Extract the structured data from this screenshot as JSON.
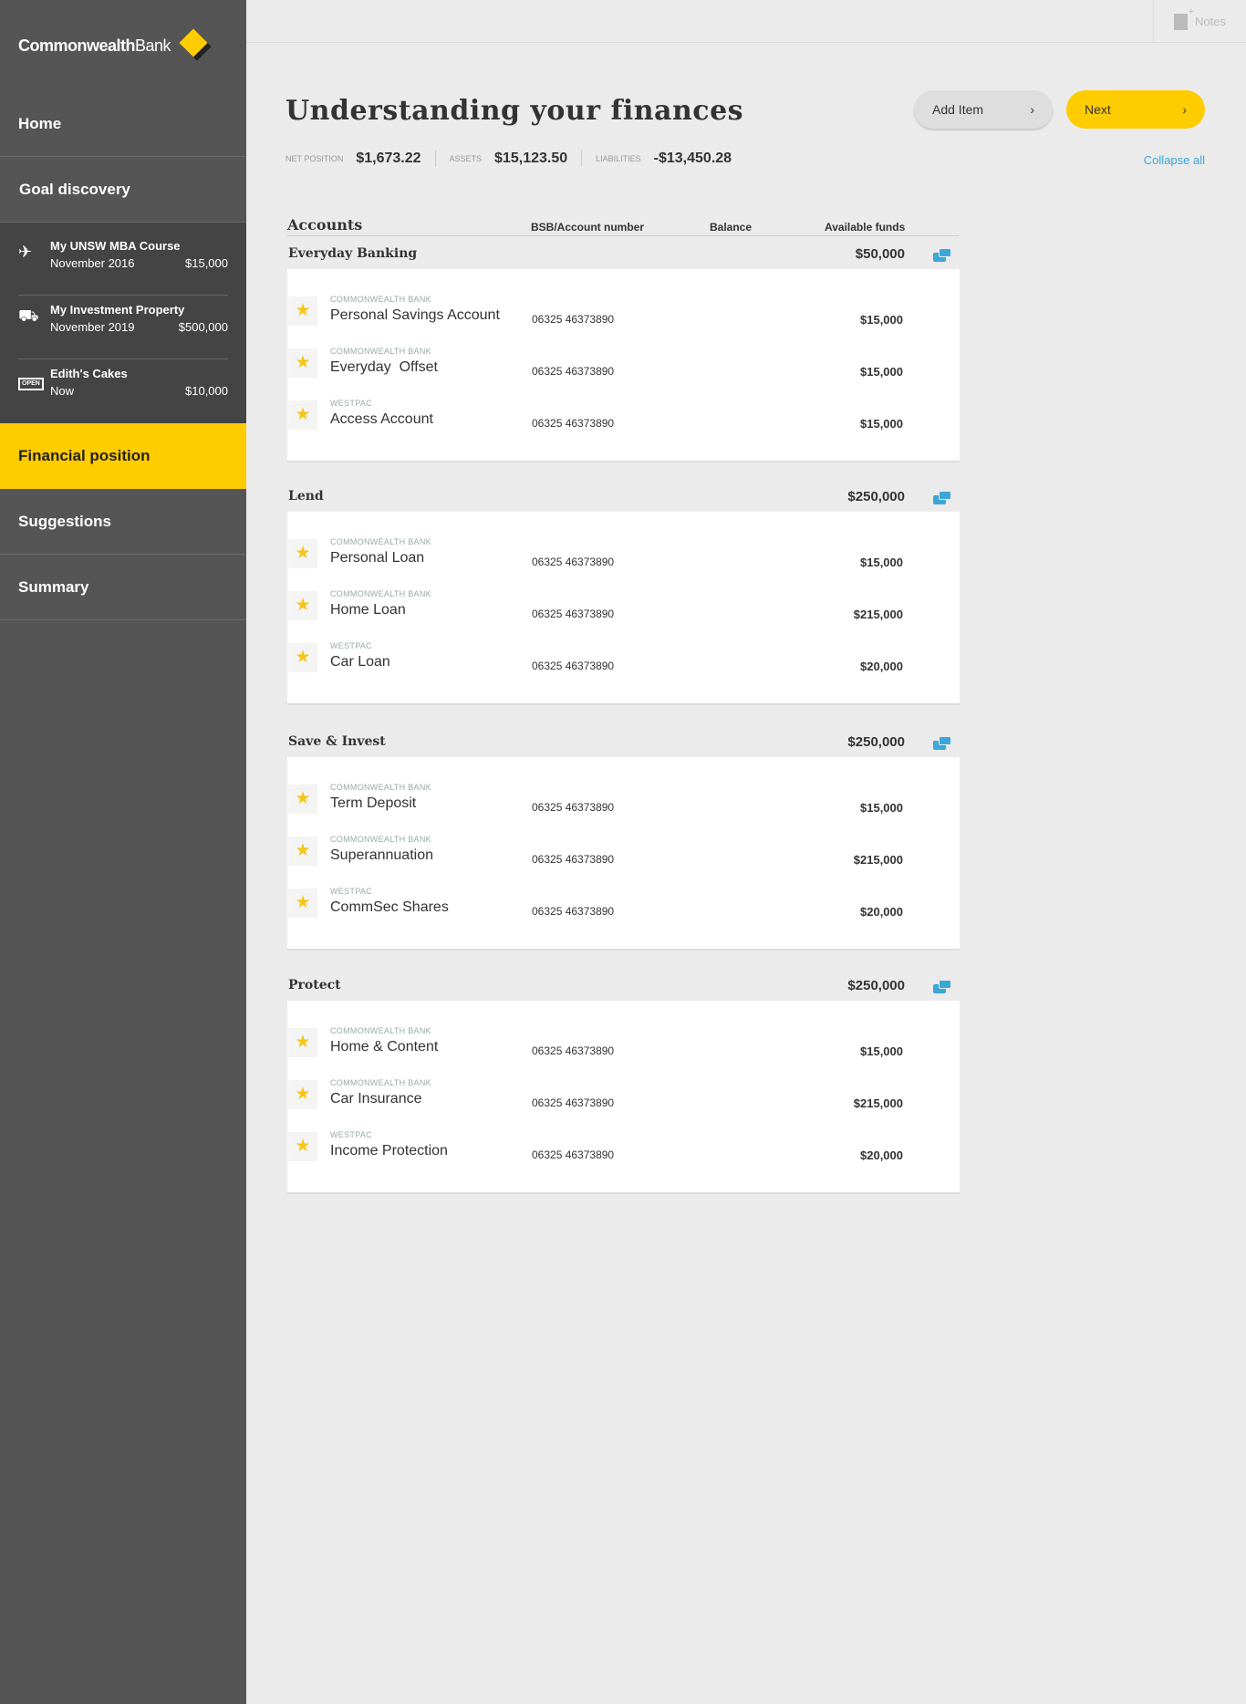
{
  "brand": {
    "logo_bold": "Commonwealth",
    "logo_regular": "Bank"
  },
  "sidebar": {
    "home": "Home",
    "goal_discovery": "Goal discovery",
    "goals": [
      {
        "icon": "plane-icon",
        "title": "My UNSW MBA Course",
        "date": "November 2016",
        "amount": "$15,000"
      },
      {
        "icon": "car-icon",
        "title": "My Investment Property",
        "date": "November 2019",
        "amount": "$500,000"
      },
      {
        "icon": "open-sign-icon",
        "icon_text": "OPEN",
        "title": "Edith's Cakes",
        "date": "Now",
        "amount": "$10,000"
      }
    ],
    "financial_position": "Financial position",
    "suggestions": "Suggestions",
    "summary": "Summary"
  },
  "topbar": {
    "notes": "Notes"
  },
  "header": {
    "title": "Understanding your finances",
    "add_item": "Add Item",
    "next": "Next",
    "chevron": "›",
    "net_position_label": "NET POSITION",
    "net_position": "$1,673.22",
    "assets_label": "ASSETS",
    "assets": "$15,123.50",
    "liabilities_label": "LIABILITIES",
    "liabilities": "-$13,450.28",
    "collapse_all": "Collapse all"
  },
  "table": {
    "headers": {
      "accounts": "Accounts",
      "bsb": "BSB/Account number",
      "balance": "Balance",
      "available": "Available funds"
    },
    "sections": [
      {
        "title": "Everyday Banking",
        "total": "$50,000",
        "rows": [
          {
            "bank": "COMMONWEALTH BANK",
            "name": "Personal Savings Account",
            "bsb": "06325 46373890",
            "amount": "$15,000"
          },
          {
            "bank": "COMMONWEALTH BANK",
            "name": "Everyday  Offset",
            "bsb": "06325 46373890",
            "amount": "$15,000"
          },
          {
            "bank": "WESTPAC",
            "name": "Access Account",
            "bsb": "06325 46373890",
            "amount": "$15,000"
          }
        ]
      },
      {
        "title": "Lend",
        "total": "$250,000",
        "rows": [
          {
            "bank": "COMMONWEALTH BANK",
            "name": "Personal Loan",
            "bsb": "06325 46373890",
            "amount": "$15,000"
          },
          {
            "bank": "COMMONWEALTH BANK",
            "name": "Home Loan",
            "bsb": "06325 46373890",
            "amount": "$215,000"
          },
          {
            "bank": "WESTPAC",
            "name": "Car Loan",
            "bsb": "06325 46373890",
            "amount": "$20,000"
          }
        ]
      },
      {
        "title": "Save & Invest",
        "total": "$250,000",
        "rows": [
          {
            "bank": "COMMONWEALTH BANK",
            "name": "Term Deposit",
            "bsb": "06325 46373890",
            "amount": "$15,000"
          },
          {
            "bank": "COMMONWEALTH BANK",
            "name": "Superannuation",
            "bsb": "06325 46373890",
            "amount": "$215,000"
          },
          {
            "bank": "WESTPAC",
            "name": "CommSec Shares",
            "bsb": "06325 46373890",
            "amount": "$20,000"
          }
        ]
      },
      {
        "title": "Protect",
        "total": "$250,000",
        "rows": [
          {
            "bank": "COMMONWEALTH BANK",
            "name": "Home & Content",
            "bsb": "06325 46373890",
            "amount": "$15,000"
          },
          {
            "bank": "COMMONWEALTH BANK",
            "name": "Car Insurance",
            "bsb": "06325 46373890",
            "amount": "$215,000"
          },
          {
            "bank": "WESTPAC",
            "name": "Income Protection",
            "bsb": "06325 46373890",
            "amount": "$20,000"
          }
        ]
      }
    ]
  },
  "colors": {
    "brand_yellow": "#ffcc00",
    "sidebar": "#555555",
    "link_blue": "#3aa7d8"
  }
}
